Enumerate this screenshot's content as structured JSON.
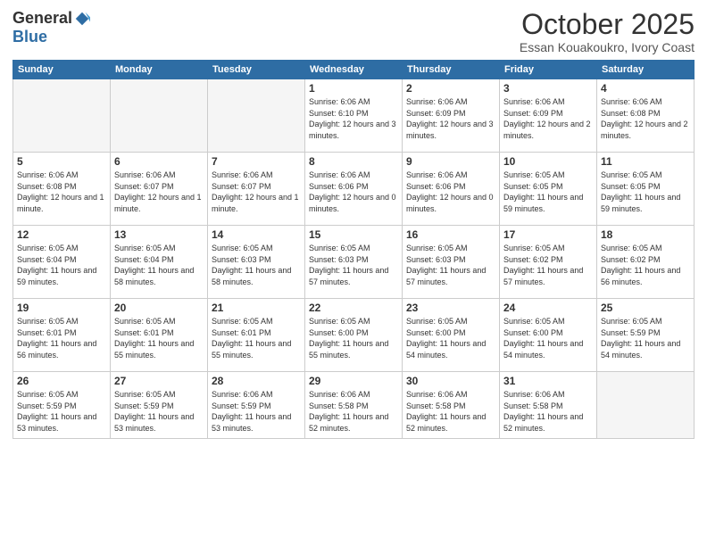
{
  "header": {
    "logo_general": "General",
    "logo_blue": "Blue",
    "month_title": "October 2025",
    "location": "Essan Kouakoukro, Ivory Coast"
  },
  "weekdays": [
    "Sunday",
    "Monday",
    "Tuesday",
    "Wednesday",
    "Thursday",
    "Friday",
    "Saturday"
  ],
  "weeks": [
    [
      {
        "day": "",
        "info": ""
      },
      {
        "day": "",
        "info": ""
      },
      {
        "day": "",
        "info": ""
      },
      {
        "day": "1",
        "info": "Sunrise: 6:06 AM\nSunset: 6:10 PM\nDaylight: 12 hours\nand 3 minutes."
      },
      {
        "day": "2",
        "info": "Sunrise: 6:06 AM\nSunset: 6:09 PM\nDaylight: 12 hours\nand 3 minutes."
      },
      {
        "day": "3",
        "info": "Sunrise: 6:06 AM\nSunset: 6:09 PM\nDaylight: 12 hours\nand 2 minutes."
      },
      {
        "day": "4",
        "info": "Sunrise: 6:06 AM\nSunset: 6:08 PM\nDaylight: 12 hours\nand 2 minutes."
      }
    ],
    [
      {
        "day": "5",
        "info": "Sunrise: 6:06 AM\nSunset: 6:08 PM\nDaylight: 12 hours\nand 1 minute."
      },
      {
        "day": "6",
        "info": "Sunrise: 6:06 AM\nSunset: 6:07 PM\nDaylight: 12 hours\nand 1 minute."
      },
      {
        "day": "7",
        "info": "Sunrise: 6:06 AM\nSunset: 6:07 PM\nDaylight: 12 hours\nand 1 minute."
      },
      {
        "day": "8",
        "info": "Sunrise: 6:06 AM\nSunset: 6:06 PM\nDaylight: 12 hours\nand 0 minutes."
      },
      {
        "day": "9",
        "info": "Sunrise: 6:06 AM\nSunset: 6:06 PM\nDaylight: 12 hours\nand 0 minutes."
      },
      {
        "day": "10",
        "info": "Sunrise: 6:05 AM\nSunset: 6:05 PM\nDaylight: 11 hours\nand 59 minutes."
      },
      {
        "day": "11",
        "info": "Sunrise: 6:05 AM\nSunset: 6:05 PM\nDaylight: 11 hours\nand 59 minutes."
      }
    ],
    [
      {
        "day": "12",
        "info": "Sunrise: 6:05 AM\nSunset: 6:04 PM\nDaylight: 11 hours\nand 59 minutes."
      },
      {
        "day": "13",
        "info": "Sunrise: 6:05 AM\nSunset: 6:04 PM\nDaylight: 11 hours\nand 58 minutes."
      },
      {
        "day": "14",
        "info": "Sunrise: 6:05 AM\nSunset: 6:03 PM\nDaylight: 11 hours\nand 58 minutes."
      },
      {
        "day": "15",
        "info": "Sunrise: 6:05 AM\nSunset: 6:03 PM\nDaylight: 11 hours\nand 57 minutes."
      },
      {
        "day": "16",
        "info": "Sunrise: 6:05 AM\nSunset: 6:03 PM\nDaylight: 11 hours\nand 57 minutes."
      },
      {
        "day": "17",
        "info": "Sunrise: 6:05 AM\nSunset: 6:02 PM\nDaylight: 11 hours\nand 57 minutes."
      },
      {
        "day": "18",
        "info": "Sunrise: 6:05 AM\nSunset: 6:02 PM\nDaylight: 11 hours\nand 56 minutes."
      }
    ],
    [
      {
        "day": "19",
        "info": "Sunrise: 6:05 AM\nSunset: 6:01 PM\nDaylight: 11 hours\nand 56 minutes."
      },
      {
        "day": "20",
        "info": "Sunrise: 6:05 AM\nSunset: 6:01 PM\nDaylight: 11 hours\nand 55 minutes."
      },
      {
        "day": "21",
        "info": "Sunrise: 6:05 AM\nSunset: 6:01 PM\nDaylight: 11 hours\nand 55 minutes."
      },
      {
        "day": "22",
        "info": "Sunrise: 6:05 AM\nSunset: 6:00 PM\nDaylight: 11 hours\nand 55 minutes."
      },
      {
        "day": "23",
        "info": "Sunrise: 6:05 AM\nSunset: 6:00 PM\nDaylight: 11 hours\nand 54 minutes."
      },
      {
        "day": "24",
        "info": "Sunrise: 6:05 AM\nSunset: 6:00 PM\nDaylight: 11 hours\nand 54 minutes."
      },
      {
        "day": "25",
        "info": "Sunrise: 6:05 AM\nSunset: 5:59 PM\nDaylight: 11 hours\nand 54 minutes."
      }
    ],
    [
      {
        "day": "26",
        "info": "Sunrise: 6:05 AM\nSunset: 5:59 PM\nDaylight: 11 hours\nand 53 minutes."
      },
      {
        "day": "27",
        "info": "Sunrise: 6:05 AM\nSunset: 5:59 PM\nDaylight: 11 hours\nand 53 minutes."
      },
      {
        "day": "28",
        "info": "Sunrise: 6:06 AM\nSunset: 5:59 PM\nDaylight: 11 hours\nand 53 minutes."
      },
      {
        "day": "29",
        "info": "Sunrise: 6:06 AM\nSunset: 5:58 PM\nDaylight: 11 hours\nand 52 minutes."
      },
      {
        "day": "30",
        "info": "Sunrise: 6:06 AM\nSunset: 5:58 PM\nDaylight: 11 hours\nand 52 minutes."
      },
      {
        "day": "31",
        "info": "Sunrise: 6:06 AM\nSunset: 5:58 PM\nDaylight: 11 hours\nand 52 minutes."
      },
      {
        "day": "",
        "info": ""
      }
    ]
  ]
}
